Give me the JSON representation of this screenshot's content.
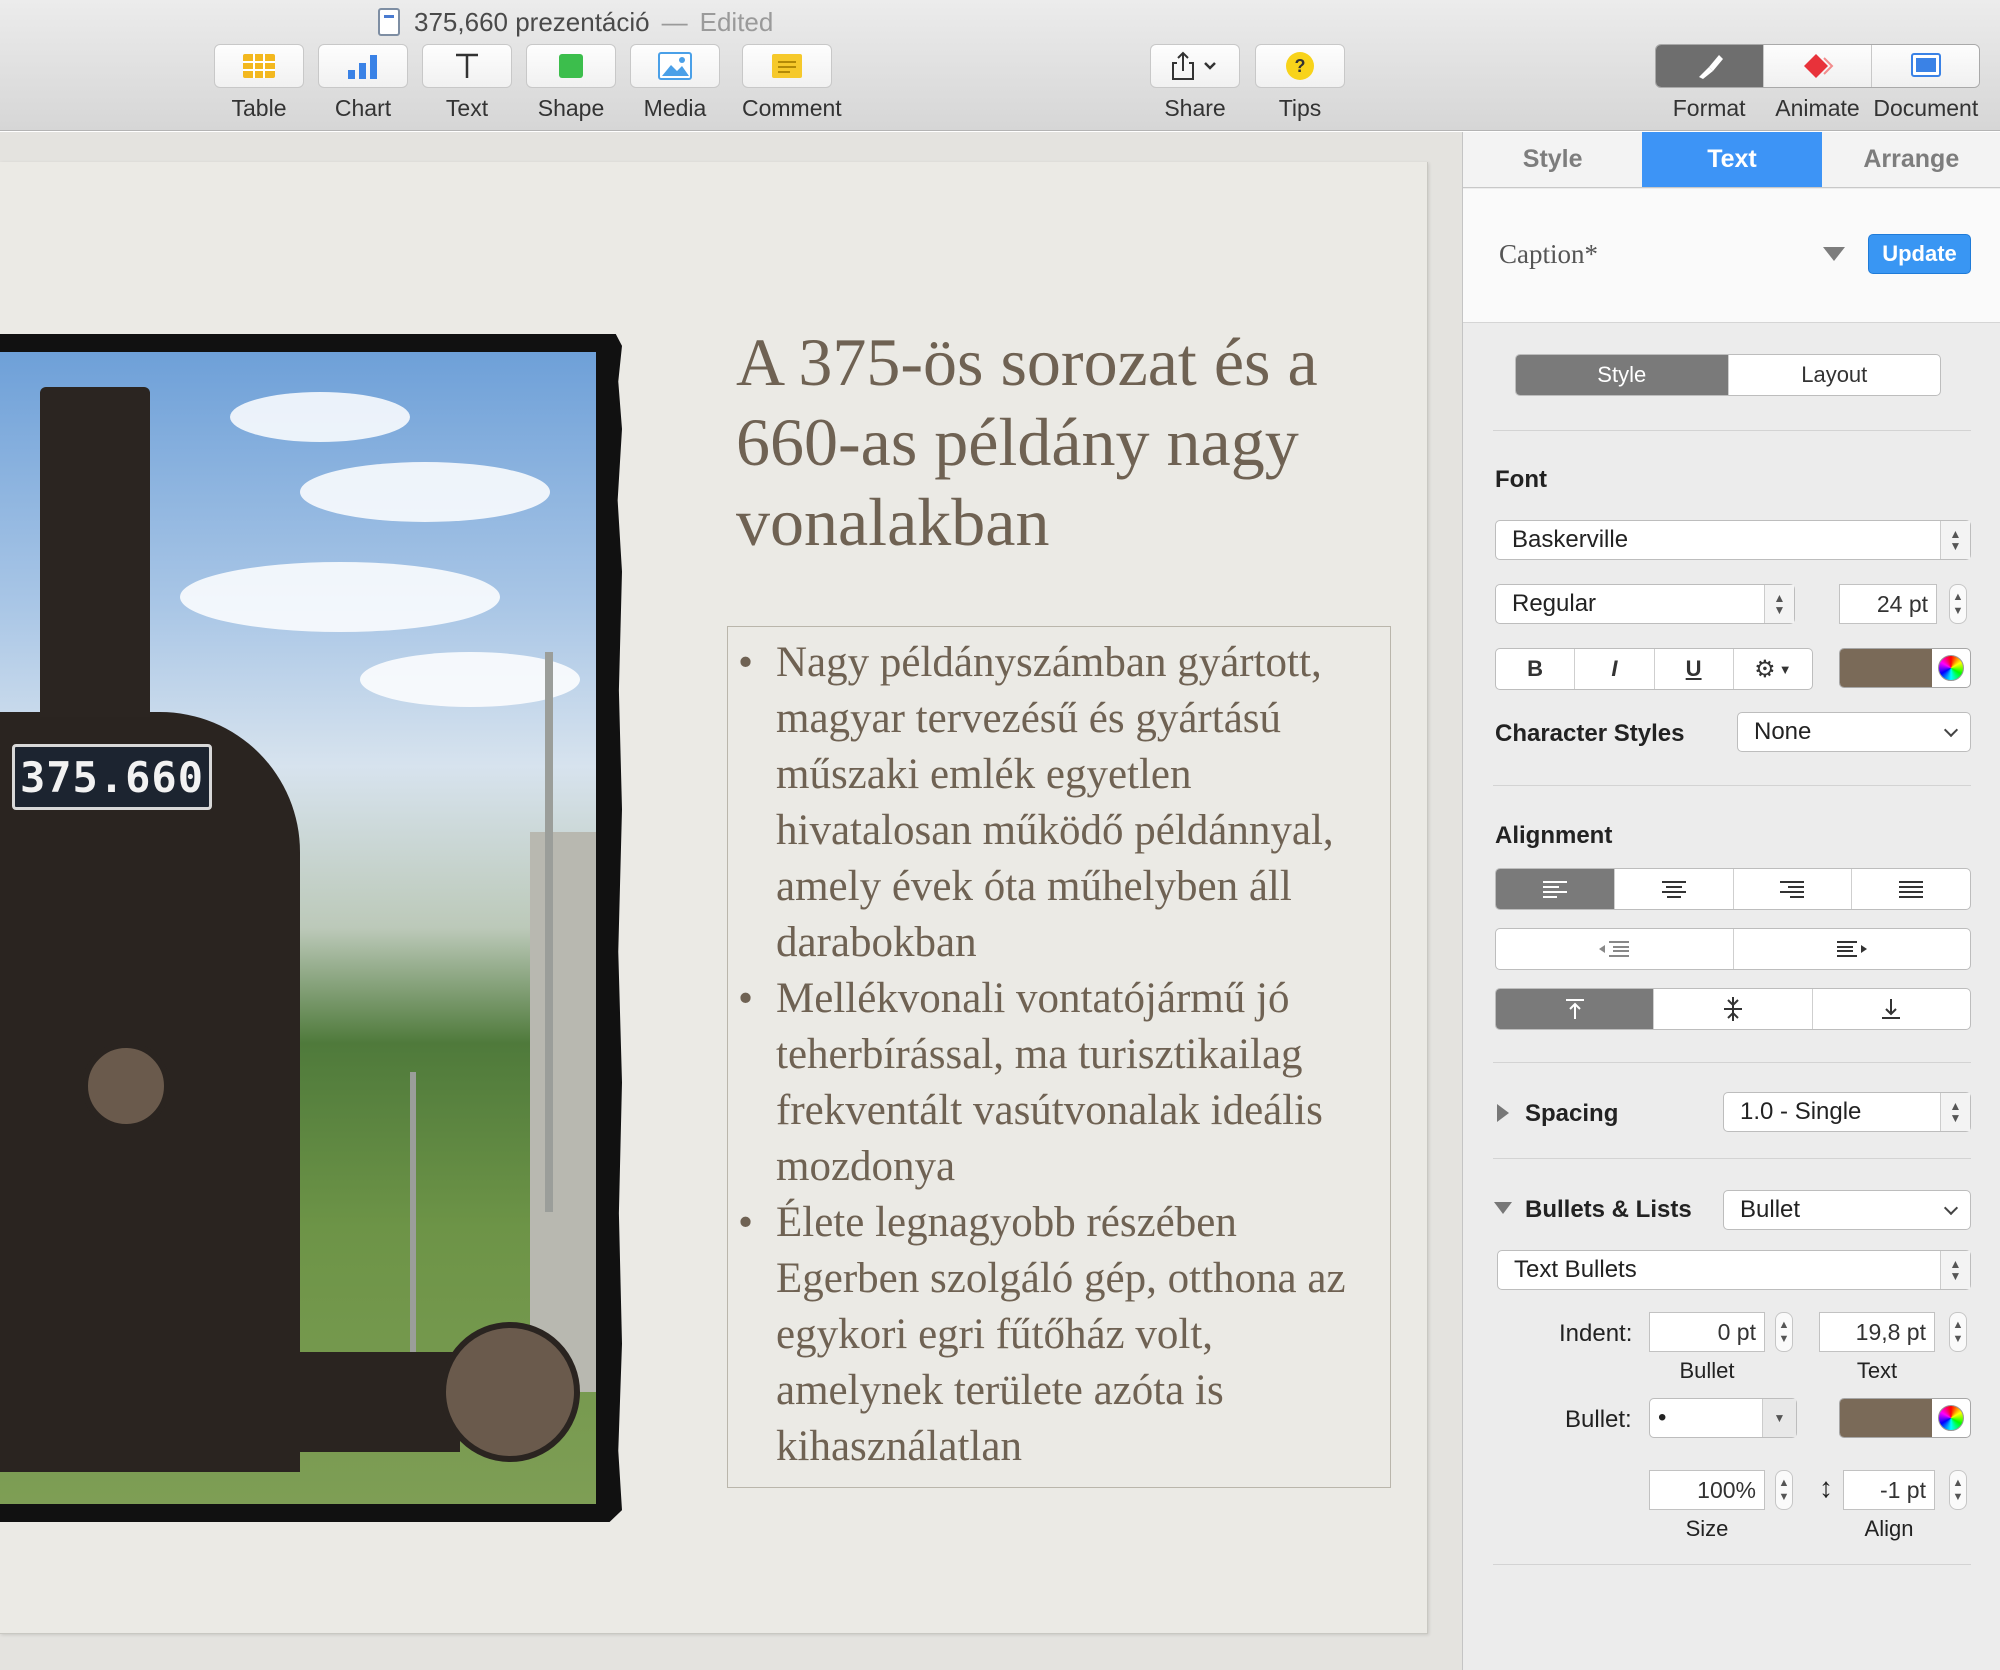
{
  "window": {
    "title": "375,660 prezentáció",
    "separator": "—",
    "status": "Edited"
  },
  "toolbar": {
    "insert": [
      {
        "id": "table",
        "label": "Table",
        "icon": "table-icon"
      },
      {
        "id": "chart",
        "label": "Chart",
        "icon": "chart-icon"
      },
      {
        "id": "text",
        "label": "Text",
        "icon": "text-icon"
      },
      {
        "id": "shape",
        "label": "Shape",
        "icon": "shape-icon"
      },
      {
        "id": "media",
        "label": "Media",
        "icon": "media-icon"
      },
      {
        "id": "comment",
        "label": "Comment",
        "icon": "comment-icon"
      }
    ],
    "share_label": "Share",
    "tips_label": "Tips",
    "tips_glyph": "?",
    "inspector_tabs": [
      {
        "label": "Format",
        "icon": "format-paintbrush-icon"
      },
      {
        "label": "Animate",
        "icon": "animate-diamond-icon"
      },
      {
        "label": "Document",
        "icon": "document-icon"
      }
    ],
    "accent_colors": {
      "table": "#f3b81f",
      "chart": "#3a82e6",
      "shape": "#3cbe4c",
      "media": "#4aa0e8",
      "comment": "#f6c92b",
      "animate": "#e8323a"
    }
  },
  "slide": {
    "title": "A 375-ös sorozat és a 660-as példány nagy vonalakban",
    "bullets": [
      "Nagy példányszámban gyártott, magyar tervezésű és gyártású műszaki emlék egyetlen hivatalosan működő példánnyal, amely évek óta műhelyben áll darabokban",
      "Mellékvonali vontatójármű jó teherbírással, ma turisztikailag frekventált vasútvonalak ideális mozdonya",
      "Élete legnagyobb részében Egerben szolgáló gép, otthona az egykori egri fűtőház volt, amelynek területe azóta is kihasználatlan"
    ],
    "photo_plate": "375.660",
    "text_color": "#6f6253"
  },
  "inspector": {
    "tabs": [
      "Style",
      "Text",
      "Arrange"
    ],
    "active_tab": "Text",
    "paragraph_style": "Caption*",
    "update_label": "Update",
    "subtabs": [
      "Style",
      "Layout"
    ],
    "font": {
      "section_label": "Font",
      "family": "Baskerville",
      "typeface": "Regular",
      "size": "24 pt",
      "bold": "B",
      "italic": "I",
      "underline": "U",
      "color": "#7a6a58"
    },
    "character_styles": {
      "label": "Character Styles",
      "value": "None"
    },
    "alignment": {
      "label": "Alignment"
    },
    "spacing": {
      "label": "Spacing",
      "value": "1.0 - Single"
    },
    "bullets_lists": {
      "label": "Bullets & Lists",
      "value": "Bullet",
      "type": "Text Bullets",
      "indent_label": "Indent:",
      "indent_bullet": "0 pt",
      "indent_text": "19,8 pt",
      "bullet_caption": "Bullet",
      "text_caption": "Text",
      "bullet_label": "Bullet:",
      "bullet_char": "•",
      "bullet_color": "#7a6a58",
      "size": "100%",
      "size_caption": "Size",
      "align": "-1 pt",
      "align_caption": "Align"
    }
  }
}
